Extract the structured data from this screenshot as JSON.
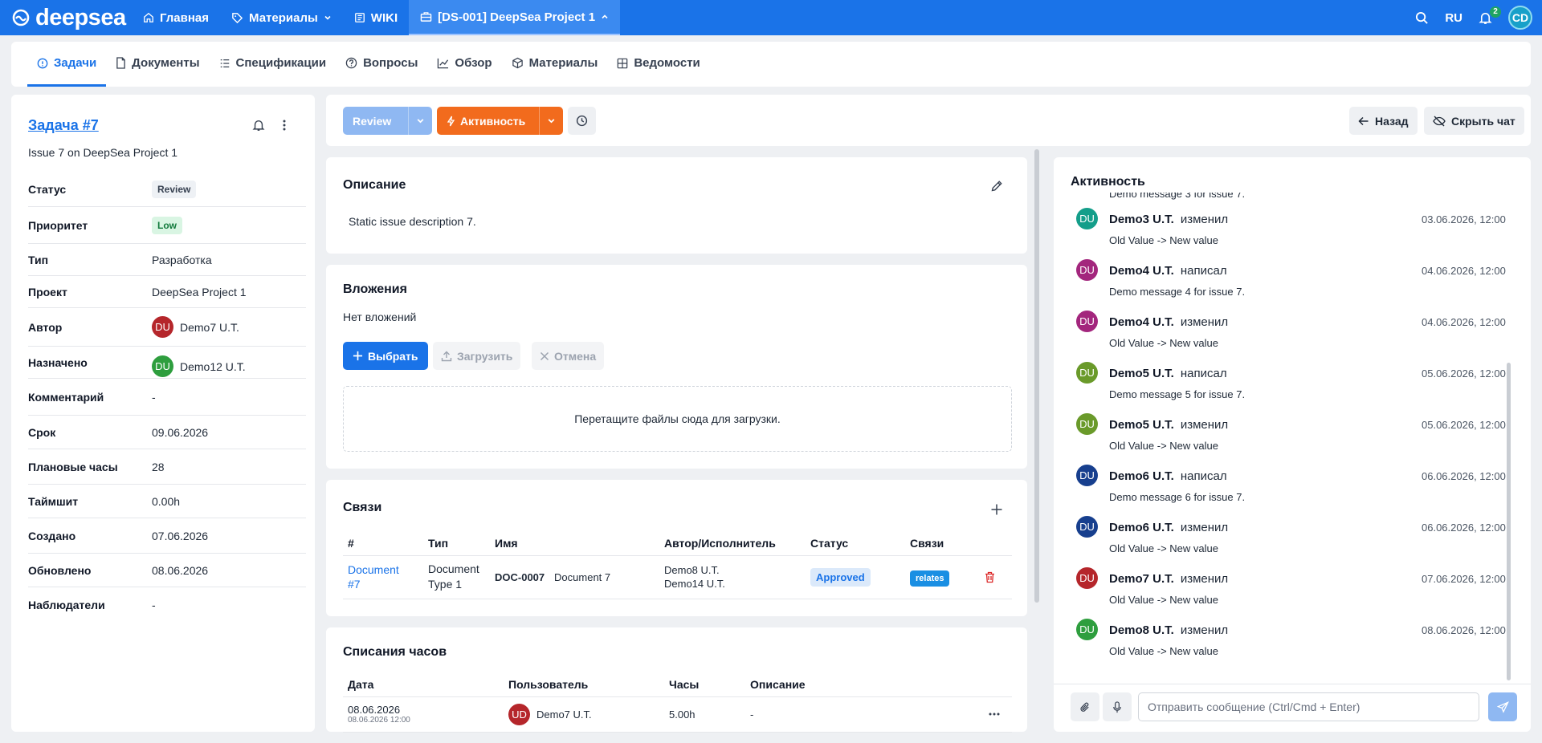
{
  "header": {
    "logo": "deepsea",
    "nav": [
      {
        "label": "Главная",
        "icon": "home-icon"
      },
      {
        "label": "Материалы",
        "icon": "tag-icon"
      },
      {
        "label": "WIKI",
        "icon": "book-icon"
      },
      {
        "label": "[DS-001] DeepSea Project 1",
        "icon": "briefcase-icon"
      }
    ],
    "lang": "RU",
    "notifications": "2",
    "user_initials": "CD"
  },
  "tabs": [
    {
      "label": "Задачи",
      "active": true
    },
    {
      "label": "Документы"
    },
    {
      "label": "Спецификации"
    },
    {
      "label": "Вопросы"
    },
    {
      "label": "Обзор"
    },
    {
      "label": "Материалы"
    },
    {
      "label": "Ведомости"
    }
  ],
  "task": {
    "title": "Задача #7",
    "subtitle": "Issue 7 on DeepSea Project 1",
    "props": [
      {
        "key": "Статус",
        "value": "Review"
      },
      {
        "key": "Приоритет",
        "value": "Low"
      },
      {
        "key": "Тип",
        "value": "Разработка"
      },
      {
        "key": "Проект",
        "value": "DeepSea Project 1"
      },
      {
        "key": "Автор",
        "value": "Demo7 U.T.",
        "initials": "DU",
        "color": "#b5262b"
      },
      {
        "key": "Назначено",
        "value": "Demo12 U.T.",
        "initials": "DU",
        "color": "#2e9e3e"
      },
      {
        "key": "Комментарий",
        "value": "-"
      },
      {
        "key": "Срок",
        "value": "09.06.2026"
      },
      {
        "key": "Плановые часы",
        "value": "28"
      },
      {
        "key": "Таймшит",
        "value": "0.00h"
      },
      {
        "key": "Создано",
        "value": "07.06.2026"
      },
      {
        "key": "Обновлено",
        "value": "08.06.2026"
      },
      {
        "key": "Наблюдатели",
        "value": "-"
      }
    ]
  },
  "toolbar": {
    "status_button": "Review",
    "activity_button": "Активность",
    "back": "Назад",
    "hide_chat": "Скрыть чат"
  },
  "description": {
    "title": "Описание",
    "text": "Static issue description 7."
  },
  "attachments": {
    "title": "Вложения",
    "empty": "Нет вложений",
    "choose": "Выбрать",
    "upload": "Загрузить",
    "cancel": "Отмена",
    "drop_hint": "Перетащите файлы сюда для загрузки."
  },
  "links": {
    "title": "Связи",
    "columns": [
      "#",
      "Тип",
      "Имя",
      "Автор/Исполнитель",
      "Статус",
      "Связи"
    ],
    "rows": [
      {
        "num_line1": "Document",
        "num_line2": "#7",
        "type_line1": "Document",
        "type_line2": "Type 1",
        "code": "DOC-0007",
        "name": "Document 7",
        "author": "Demo8 U.T.",
        "assignee": "Demo14 U.T.",
        "status": "Approved",
        "relation": "relates"
      }
    ]
  },
  "timelog": {
    "title": "Списания часов",
    "columns": [
      "Дата",
      "Пользователь",
      "Часы",
      "Описание"
    ],
    "rows": [
      {
        "date": "08.06.2026",
        "datetime": "08.06.2026 12:00",
        "user": "Demo7 U.T.",
        "initials": "UD",
        "color": "#b5262b",
        "hours": "5.00h",
        "description": "-"
      }
    ]
  },
  "activity": {
    "title": "Активность",
    "partial_top": "Demo message 3 for issue 7.",
    "entries": [
      {
        "user": "Demo3 U.T.",
        "action": "изменил",
        "date": "03.06.2026, 12:00",
        "msg": "Old Value -> New value",
        "initials": "DU",
        "color": "#149e8a",
        "forward": false
      },
      {
        "user": "Demo4 U.T.",
        "action": "написал",
        "date": "04.06.2026, 12:00",
        "msg": "Demo message 4 for issue 7.",
        "initials": "DU",
        "color": "#a3267d",
        "forward": true
      },
      {
        "user": "Demo4 U.T.",
        "action": "изменил",
        "date": "04.06.2026, 12:00",
        "msg": "Old Value -> New value",
        "initials": "DU",
        "color": "#a3267d",
        "forward": false
      },
      {
        "user": "Demo5 U.T.",
        "action": "написал",
        "date": "05.06.2026, 12:00",
        "msg": "Demo message 5 for issue 7.",
        "initials": "DU",
        "color": "#6a9a2a",
        "forward": true
      },
      {
        "user": "Demo5 U.T.",
        "action": "изменил",
        "date": "05.06.2026, 12:00",
        "msg": "Old Value -> New value",
        "initials": "DU",
        "color": "#6a9a2a",
        "forward": false
      },
      {
        "user": "Demo6 U.T.",
        "action": "написал",
        "date": "06.06.2026, 12:00",
        "msg": "Demo message 6 for issue 7.",
        "initials": "DU",
        "color": "#173f8e",
        "forward": true
      },
      {
        "user": "Demo6 U.T.",
        "action": "изменил",
        "date": "06.06.2026, 12:00",
        "msg": "Old Value -> New value",
        "initials": "DU",
        "color": "#173f8e",
        "forward": false
      },
      {
        "user": "Demo7 U.T.",
        "action": "изменил",
        "date": "07.06.2026, 12:00",
        "msg": "Old Value -> New value",
        "initials": "DU",
        "color": "#b5262b",
        "forward": false
      },
      {
        "user": "Demo8 U.T.",
        "action": "изменил",
        "date": "08.06.2026, 12:00",
        "msg": "Old Value -> New value",
        "initials": "DU",
        "color": "#2e9e3e",
        "forward": false
      }
    ],
    "input_placeholder": "Отправить сообщение (Ctrl/Cmd + Enter)"
  }
}
